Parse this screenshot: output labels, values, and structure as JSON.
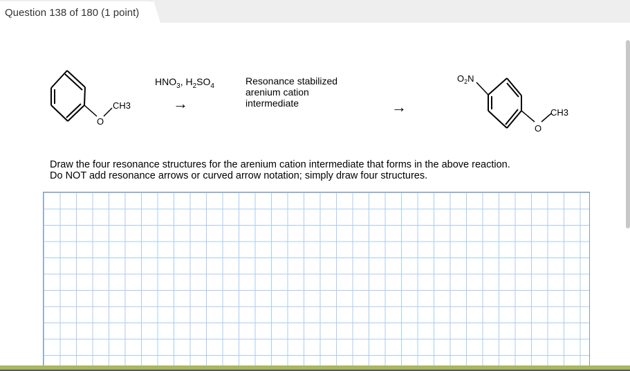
{
  "header": {
    "question_label": "Question 138 of 180 (1 point)"
  },
  "reaction": {
    "reactant_substituent": "CH3",
    "reactant_oxygen": "O",
    "reagents": {
      "a": "HNO",
      "a_sub": "3",
      "sep": ", H",
      "b_sub1": "2",
      "b": "SO",
      "b_sub2": "4"
    },
    "intermediate_lines": [
      "Resonance stabilized",
      "arenium cation",
      "intermediate"
    ],
    "product_nitro": {
      "o": "O",
      "sub": "2",
      "n": "N"
    },
    "product_substituent": "CH3",
    "product_oxygen": "O",
    "arrow": "→"
  },
  "instructions": [
    "Draw the four resonance structures for the arenium cation intermediate that forms in the above reaction.",
    "Do NOT add resonance arrows or curved arrow notation; simply draw four structures."
  ],
  "colors": {
    "grid": "#a9cbef",
    "footer": "#a9b85a",
    "topbar": "#eeeeee"
  }
}
